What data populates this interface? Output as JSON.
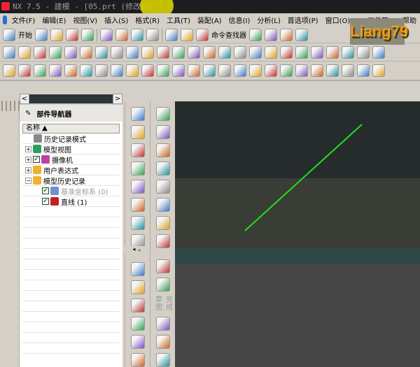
{
  "window": {
    "title": "NX 7.5 - 建模 - [05.prt (修改的) ]"
  },
  "menu": [
    "文件(F)",
    "编辑(E)",
    "视图(V)",
    "插入(S)",
    "格式(R)",
    "工具(T)",
    "装配(A)",
    "信息(I)",
    "分析(L)",
    "首选项(P)",
    "窗口(O)",
    "GC工具箱",
    "",
    "帮助"
  ],
  "toolbar1": {
    "start_label": "开始",
    "command_finder_label": "命令查找器",
    "icons": [
      "new-icon",
      "open-icon",
      "save-icon",
      "print-icon",
      "cut-icon",
      "copy-icon",
      "paste-icon",
      "delete-icon",
      "undo-icon",
      "redo-icon",
      "binoculars-icon",
      "link-icon",
      "layer-icon",
      "equals-icon",
      "table-icon"
    ]
  },
  "watermark": "Liang79",
  "toolbar2_icons": [
    "sketch-icon",
    "rectangle-icon",
    "extrude-icon",
    "revolve-icon",
    "hole-icon",
    "boss-icon",
    "pad-icon",
    "block-icon",
    "cylinder-icon",
    "cone-icon",
    "sphere-icon",
    "edge-blend-icon",
    "chamfer-icon",
    "shell-icon",
    "trim-icon",
    "offset-icon",
    "thicken-icon",
    "pattern-icon",
    "mirror-icon",
    "unite-icon",
    "subtract-icon",
    "intersect-icon",
    "draft-icon",
    "sew-icon",
    "surface-icon"
  ],
  "toolbar3_icons": [
    "line-icon",
    "arc-icon",
    "circle-icon",
    "rectangle-icon",
    "spline-icon",
    "text-icon",
    "curve-icon",
    "offset-curve-icon",
    "bridge-icon",
    "project-icon",
    "intersect-curve-icon",
    "section-icon",
    "extract-icon",
    "wrap-icon",
    "helix-icon",
    "join-icon",
    "divide-icon",
    "trim-curve-icon",
    "fillet-icon",
    "point-icon",
    "plane-icon",
    "csys-icon",
    "view-icon",
    "render-icon",
    "analysis-icon"
  ],
  "left_tabs": [
    "assembly-navigator-icon",
    "part-navigator-icon",
    "reuse-library-icon",
    "info-icon",
    "web-icon",
    "history-icon",
    "roles-icon",
    "palette-icon",
    "process-icon",
    "system-icon"
  ],
  "navigator": {
    "title": "部件导航器",
    "column": "名称",
    "rows": [
      {
        "label": "历史记录模式",
        "expander": "",
        "icon": "clock-icon",
        "color": "#888",
        "check": false,
        "gray": false,
        "indent": 1
      },
      {
        "label": "模型视图",
        "expander": "+",
        "icon": "model-views-icon",
        "color": "#2aa060",
        "check": false,
        "gray": false,
        "indent": 0
      },
      {
        "label": "摄像机",
        "expander": "+",
        "icon": "camera-icon",
        "color": "#c040a0",
        "check": true,
        "gray": false,
        "indent": 0
      },
      {
        "label": "用户表达式",
        "expander": "+",
        "icon": "folder-icon",
        "color": "#f0b030",
        "check": false,
        "gray": false,
        "indent": 0
      },
      {
        "label": "模型历史记录",
        "expander": "-",
        "icon": "folder-icon",
        "color": "#f0b030",
        "check": false,
        "gray": false,
        "indent": 0
      },
      {
        "label": "基准坐标系 (0)",
        "expander": "",
        "icon": "datum-csys-icon",
        "color": "#7090d0",
        "check": true,
        "gray": true,
        "indent": 2
      },
      {
        "label": "直线 (1)",
        "expander": "",
        "icon": "line-icon",
        "color": "#c02020",
        "check": true,
        "gray": false,
        "indent": 2
      }
    ]
  },
  "vtoolbar1_icons": [
    "plane-patch-icon",
    "ruled-icon",
    "through-curves-icon",
    "law-extension-icon",
    "offset-surface-icon",
    "sweep-icon",
    "studio-surface-icon",
    "bounded-plane-icon",
    "extend-icon",
    "trimmed-sheet-icon",
    "sew-surface-icon",
    "blend-surface-icon",
    "face-blend-icon",
    "thicken-sheet-icon"
  ],
  "vtoolbar2_icons": [
    "sketch-curve-icon",
    "trim-icon",
    "quick-trim-icon",
    "quick-extend-icon",
    "fillet-icon",
    "chamfer-icon",
    "offset-icon",
    "constraint-icon"
  ],
  "vtoolbar2_lower": {
    "icons": [
      "sketch-finish-icon",
      "grid-icon"
    ],
    "finish_sketch_label": "完成草图",
    "tail_icons": [
      "profile-icon",
      "line-icon",
      "angle-icon"
    ]
  },
  "viewport": {
    "line_color": "#22dd22",
    "bands": [
      "#262c2c",
      "#3a3d35",
      "#2e4848",
      "#464646"
    ]
  }
}
